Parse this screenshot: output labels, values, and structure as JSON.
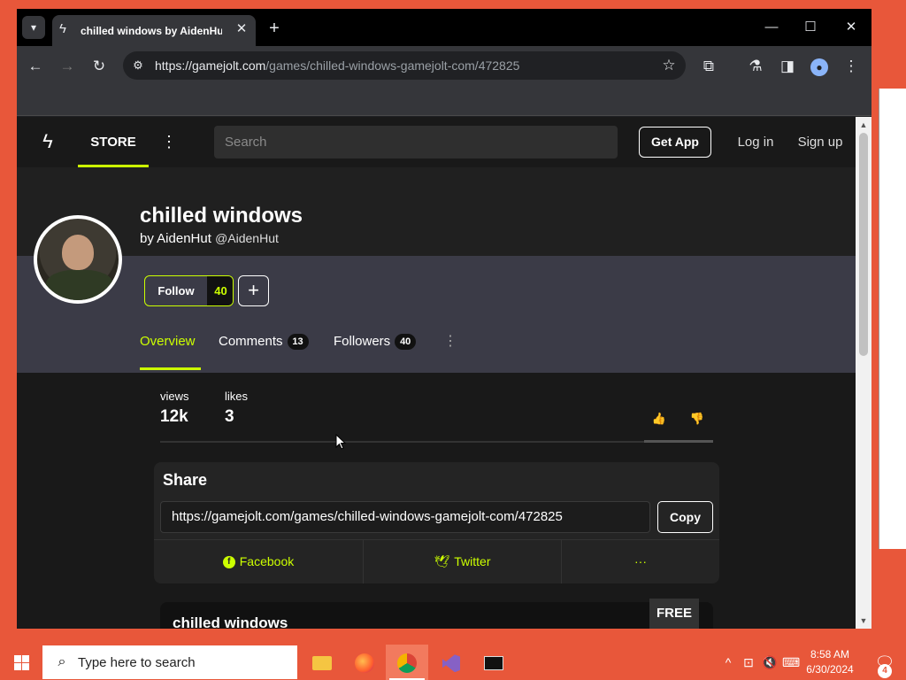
{
  "browser": {
    "tab_title": "chilled windows by AidenHut - Game Jolt",
    "url_host": "https://gamejolt.com",
    "url_path": "/games/chilled-windows-gamejolt-com/472825"
  },
  "gamejolt": {
    "nav": {
      "store": "STORE",
      "search_placeholder": "Search",
      "get_app": "Get App",
      "login": "Log in",
      "signup": "Sign up"
    },
    "game": {
      "title": "chilled windows",
      "by": "by AidenHut",
      "handle": "@AidenHut"
    },
    "follow": {
      "label": "Follow",
      "count": "40",
      "plus": "+"
    },
    "tabs": [
      {
        "label": "Overview",
        "count": null
      },
      {
        "label": "Comments",
        "count": "13"
      },
      {
        "label": "Followers",
        "count": "40"
      }
    ],
    "stats": {
      "views_label": "views",
      "views_value": "12k",
      "likes_label": "likes",
      "likes_value": "3"
    },
    "share": {
      "title": "Share",
      "url": "https://gamejolt.com/games/chilled-windows-gamejolt-com/472825",
      "copy": "Copy",
      "facebook": "Facebook",
      "twitter": "Twitter",
      "more": "···"
    },
    "game_card": {
      "title": "chilled windows",
      "price": "FREE"
    }
  },
  "taskbar": {
    "search_placeholder": "Type here to search",
    "time": "8:58 AM",
    "date": "6/30/2024",
    "notifications": "4"
  },
  "colors": {
    "accent": "#ccff00",
    "page_bg": "#191919",
    "band_bg": "#3b3b47",
    "taskbar": "#e8573a"
  }
}
